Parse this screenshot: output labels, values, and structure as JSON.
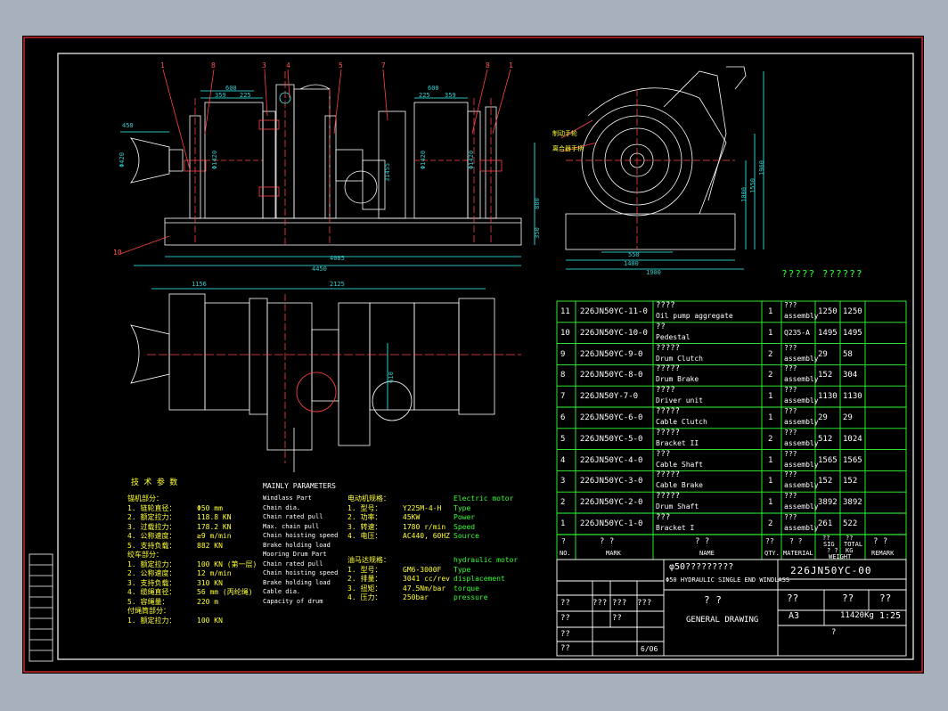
{
  "drawing": {
    "part_no": "226JN50YC-00",
    "title_cn": "φ50?????????",
    "title_en": "Φ50 HYDRAULIC SINGLE END WINDLASS",
    "sub_q": "? ?",
    "view_name": "GENERAL DRAWING",
    "sheet_size": "A3",
    "weight": "11420Kg",
    "scale": "1:25",
    "sheet_no": "6/06",
    "header_q1": "??",
    "header_q2": "??",
    "header_q3": "??",
    "tb_q1": "??",
    "tb_q2": "???",
    "tb_q3": "???",
    "tb_q4": "???",
    "tb_q5": "??",
    "tb_q6": "??",
    "tb_q7": "??",
    "tb_q8": "??",
    "bottom_q": "?",
    "parts_table_title": "?????  ??????"
  },
  "parts_table": {
    "headers": {
      "no": "NO.",
      "no_q": "?",
      "mark": "MARK",
      "mark_q": "?   ?",
      "name": "NAME",
      "name_q": "?   ?",
      "qty": "QTY.",
      "qty_q": "??",
      "material": "MATERIAL",
      "material_q": "?  ?",
      "single": "SIG",
      "single_q": "??",
      "total": "TOTAL",
      "total_q": "??",
      "weight": "WEIGHT",
      "weight_q": "? ?",
      "kg": "KG",
      "remark": "REMARK",
      "remark_q": "? ?"
    },
    "rows": [
      {
        "no": "11",
        "mark": "226JN50YC-11-0",
        "name_cn": "????",
        "name": "Oil pump aggregate",
        "qty": "1",
        "mat_q": "???",
        "mat": "assembly",
        "sig": "1250",
        "total": "1250"
      },
      {
        "no": "10",
        "mark": "226JN50YC-10-0",
        "name_cn": "??",
        "name": "Pedestal",
        "qty": "1",
        "mat_q": "",
        "mat": "Q235-A",
        "sig": "1495",
        "total": "1495"
      },
      {
        "no": "9",
        "mark": "226JN50YC-9-0",
        "name_cn": "?????",
        "name": "Drum Clutch",
        "qty": "2",
        "mat_q": "???",
        "mat": "assembly",
        "sig": "29",
        "total": "58"
      },
      {
        "no": "8",
        "mark": "226JN50YC-8-0",
        "name_cn": "?????",
        "name": "Drum Brake",
        "qty": "2",
        "mat_q": "???",
        "mat": "assembly",
        "sig": "152",
        "total": "304"
      },
      {
        "no": "7",
        "mark": "226JN50Y-7-0",
        "name_cn": "????",
        "name": "Driver unit",
        "qty": "1",
        "mat_q": "???",
        "mat": "assembly",
        "sig": "1130",
        "total": "1130"
      },
      {
        "no": "6",
        "mark": "226JN50YC-6-0",
        "name_cn": "?????",
        "name": "Cable Clutch",
        "qty": "1",
        "mat_q": "???",
        "mat": "assembly",
        "sig": "29",
        "total": "29"
      },
      {
        "no": "5",
        "mark": "226JN50YC-5-0",
        "name_cn": "?????",
        "name": "Bracket II",
        "qty": "2",
        "mat_q": "???",
        "mat": "assembly",
        "sig": "512",
        "total": "1024"
      },
      {
        "no": "4",
        "mark": "226JN50YC-4-0",
        "name_cn": "???",
        "name": "Cable Shaft",
        "qty": "1",
        "mat_q": "???",
        "mat": "assembly",
        "sig": "1565",
        "total": "1565"
      },
      {
        "no": "3",
        "mark": "226JN50YC-3-0",
        "name_cn": "?????",
        "name": "Cable Brake",
        "qty": "1",
        "mat_q": "???",
        "mat": "assembly",
        "sig": "152",
        "total": "152"
      },
      {
        "no": "2",
        "mark": "226JN50YC-2-0",
        "name_cn": "?????",
        "name": "Drum Shaft",
        "qty": "1",
        "mat_q": "???",
        "mat": "assembly",
        "sig": "3892",
        "total": "3892"
      },
      {
        "no": "1",
        "mark": "226JN50YC-1-0",
        "name_cn": "???",
        "name": "Bracket I",
        "qty": "2",
        "mat_q": "???",
        "mat": "assembly",
        "sig": "261",
        "total": "522"
      }
    ]
  },
  "params": {
    "heading_cn": "技 术 参 数",
    "heading_en": "MAINLY PARAMETERS",
    "cn": [
      "锚机部分：",
      "1. 链轮直径：",
      "2. 额定拉力：",
      "3. 过载拉力：",
      "4. 公称速度：",
      "5. 支持负载：",
      "绞车部分：",
      "1. 额定拉力：",
      "2. 公称速度：",
      "3. 支持负载：",
      "4. 缆绳直径：",
      "5. 容绳量：",
      "付绳筒部分：",
      "1. 额定拉力："
    ],
    "vals": [
      "",
      "Φ50 mm",
      "118.8 KN",
      "178.2 KN",
      "≥9 m/min",
      "882 KN",
      "",
      "100 KN (第一层)",
      "12 m/min",
      "310 KN",
      "56 mm (丙纶绳)",
      "220 m",
      "",
      "100 KN"
    ],
    "en": [
      "Windlass Part",
      "Chain dia.",
      "Chain rated pull",
      "Max. chain pull",
      "Chain hoisting speed",
      "Brake holding load",
      "Mooring Drum Part",
      "Chain rated pull",
      "Chain hoisting speed",
      "Brake holding load",
      "Cable dia.",
      "Capacity of drum"
    ],
    "motor_cn": [
      "电动机规格：",
      "1. 型号：",
      "2. 功率：",
      "3. 转速：",
      "4. 电压："
    ],
    "motor_vals": [
      "",
      "Y225M-4-H",
      "45KW",
      "1780 r/min",
      "AC440, 60HZ"
    ],
    "motor_en": [
      "Electric motor",
      "Type",
      "Power",
      "Speed",
      "Source"
    ],
    "hyd_cn": [
      "油马达规格：",
      "1. 型号：",
      "2. 排量：",
      "3. 扭矩：",
      "4. 压力："
    ],
    "hyd_vals": [
      "",
      "GM6-3000F",
      "3041 cc/rev",
      "47.5Nm/bar",
      "250bar"
    ],
    "hyd_en": [
      "hydraulic motor",
      "Type",
      "displacement",
      "torque",
      "pressure"
    ]
  },
  "dims": {
    "front": [
      "600",
      "359",
      "225",
      "600",
      "225",
      "359",
      "450",
      "Φ420",
      "Φ1420",
      "Φ1420",
      "Φ1420",
      "31455",
      "880",
      "350",
      "4085",
      "4450"
    ],
    "plan": [
      "1156",
      "2125",
      "610"
    ],
    "side": [
      "550",
      "1400",
      "1900",
      "1000",
      "1550",
      "1960"
    ],
    "balloons": [
      "1",
      "8",
      "3",
      "4",
      "5",
      "7",
      "8",
      "1",
      "10"
    ],
    "side_notes": [
      "制动手轮",
      "离合器手柄"
    ]
  },
  "revision_cells": [
    "标记",
    "处",
    "",
    "",
    "",
    "",
    "",
    "",
    "",
    ""
  ]
}
